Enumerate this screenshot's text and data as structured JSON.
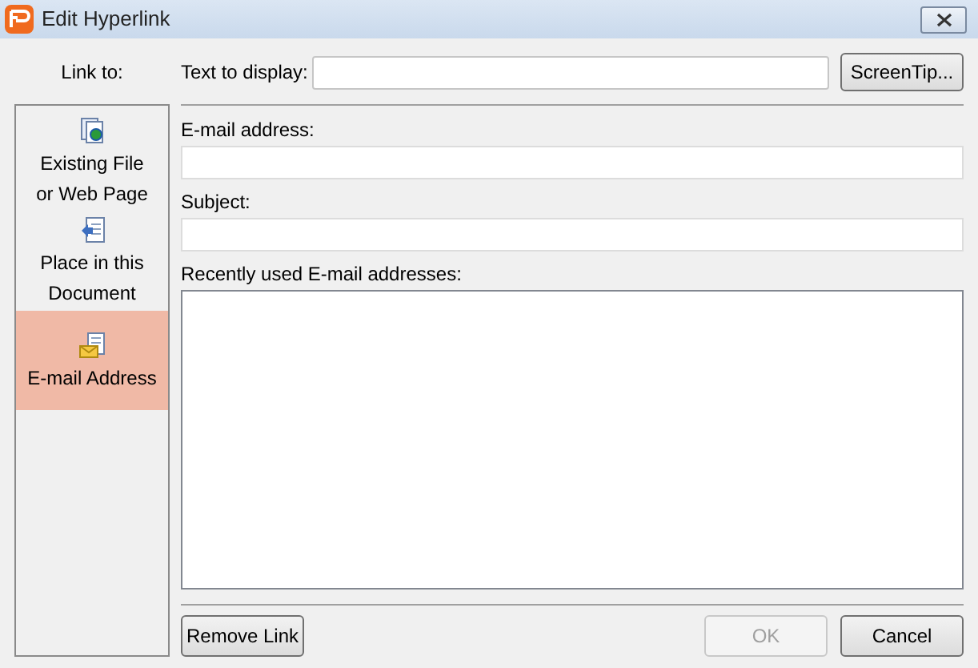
{
  "window": {
    "title": "Edit Hyperlink"
  },
  "link_to_label": "Link to:",
  "sidebar": {
    "items": [
      {
        "label_lines": [
          "Existing File",
          "or Web Page"
        ],
        "kind": "file",
        "selected": false
      },
      {
        "label_lines": [
          "Place in this",
          "Document"
        ],
        "kind": "place",
        "selected": false
      },
      {
        "label_lines": [
          "E-mail Address"
        ],
        "kind": "email",
        "selected": true
      }
    ]
  },
  "text_to_display": {
    "label": "Text to display:"
  },
  "screentip_button": "ScreenTip...",
  "email_address": {
    "label": "E-mail address:"
  },
  "subject": {
    "label": "Subject:"
  },
  "recent": {
    "label": "Recently used E-mail addresses:"
  },
  "buttons": [
    {
      "label": "Remove Link",
      "disabled": false
    },
    {
      "label": "OK",
      "disabled": true
    },
    {
      "label": "Cancel",
      "disabled": false
    }
  ]
}
